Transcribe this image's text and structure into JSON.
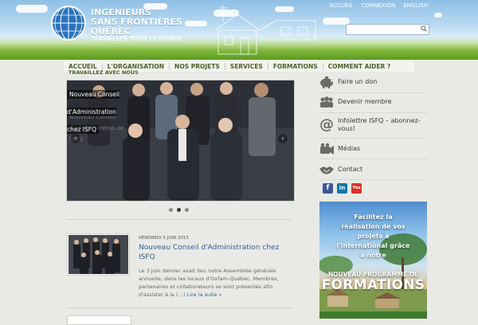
{
  "header": {
    "brand_line1": "INGÉNIEURS",
    "brand_line2": "SANS FRONTIÈRES",
    "brand_line3": "QUÉBEC",
    "tagline": "TRAVAILLER POUR LE MONDE",
    "top_links": [
      "ACCUEIL",
      "CONNEXION",
      "ENGLISH"
    ],
    "search_placeholder": ""
  },
  "nav": {
    "items": [
      "ACCUEIL",
      "L'ORGANISATION",
      "NOS PROJETS",
      "SERVICES",
      "FORMATIONS",
      "COMMENT AIDER ?"
    ],
    "items_row2": [
      "TRAVAILLEZ AVEC NOUS"
    ]
  },
  "slider": {
    "caption": "Nouveau Conseil d'Administration chez ISFQ",
    "ghost_text": "Nouveau Conseil d'Administration de l'ÉTS",
    "prev_icon": "chevron-left-icon",
    "next_icon": "chevron-right-icon",
    "slide_count": 3,
    "active_slide": 2
  },
  "news": {
    "date": "VENDREDI 5 JUIN 2015",
    "title": "Nouveau Conseil d'Administration chez ISFQ",
    "body": "Le 3 juin dernier avait lieu notre Assemblée générale annuelle, dans les locaux d'Oxfam-Québec. Membres, partenaires et collaborateurs se sont présentés afin d'assister à la (…)",
    "read_more": "Lire la suite »"
  },
  "sidebar": {
    "items": [
      {
        "label": "Faire un don",
        "icon": "piggy-bank-icon"
      },
      {
        "label": "Devenir membre",
        "icon": "people-icon"
      },
      {
        "label": "Infolettre ISFQ – abonnez-vous!",
        "icon": "at-sign-icon"
      },
      {
        "label": "Médias",
        "icon": "camera-icon"
      },
      {
        "label": "Contact",
        "icon": "handshake-icon"
      }
    ],
    "social": [
      {
        "icon": "facebook-icon",
        "glyph": "f",
        "color": "#3b5998"
      },
      {
        "icon": "linkedin-icon",
        "glyph": "in",
        "color": "#0e76a8"
      },
      {
        "icon": "youtube-icon",
        "glyph": "You",
        "color": "#d9302a"
      }
    ],
    "banner": {
      "promo_text": "Facilitez la réalisation de vos projets à l'international grâce à notre",
      "headline_small": "NOUVEAU PROGRAMME DE",
      "headline_big": "FORMATIONS"
    }
  }
}
